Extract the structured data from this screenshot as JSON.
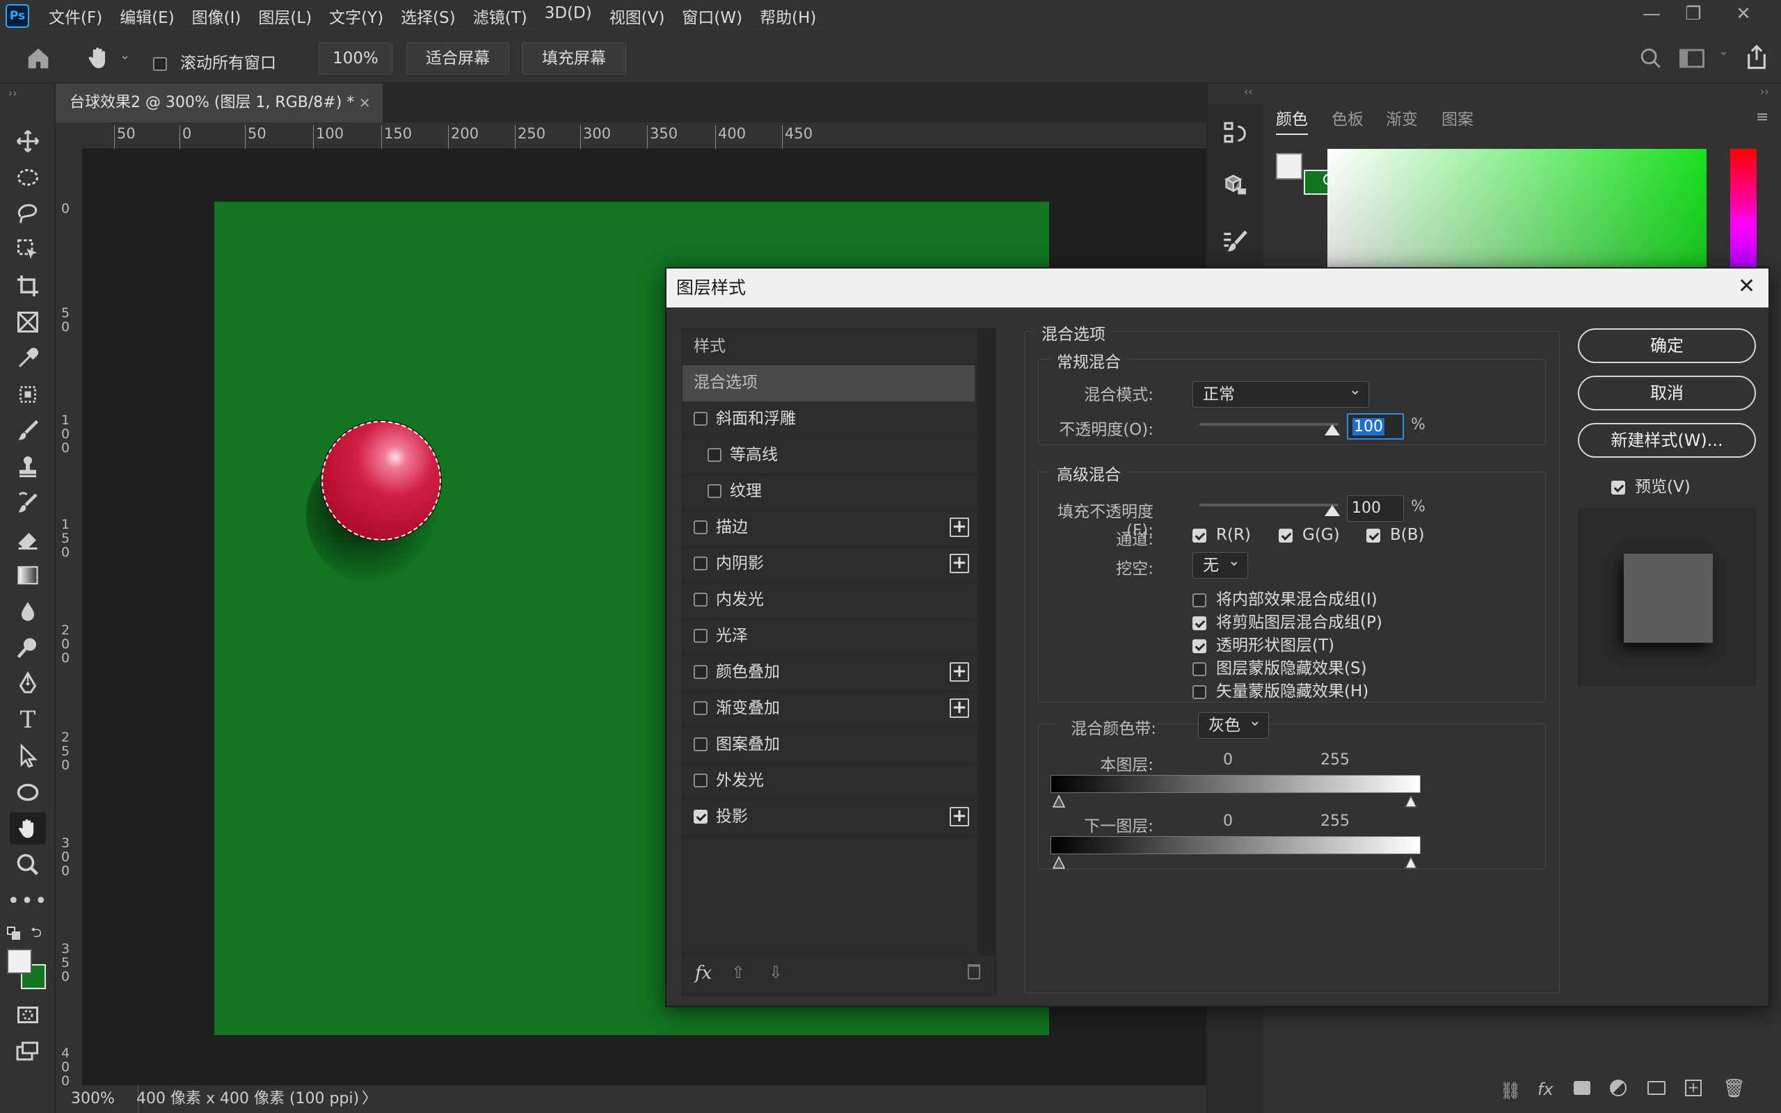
{
  "menubar": {
    "logo": "Ps",
    "items": [
      "文件(F)",
      "编辑(E)",
      "图像(I)",
      "图层(L)",
      "文字(Y)",
      "选择(S)",
      "滤镜(T)",
      "3D(D)",
      "视图(V)",
      "窗口(W)",
      "帮助(H)"
    ]
  },
  "optbar": {
    "scroll_all_label": "滚动所有窗口",
    "zoom_value": "100%",
    "fit_screen": "适合屏幕",
    "fill_screen": "填充屏幕"
  },
  "document": {
    "tab_title": "台球效果2 @ 300% (图层 1, RGB/8#) *",
    "canvas_color": "#117522",
    "ball_color": "#d21f45"
  },
  "ruler": {
    "top_ticks": [
      "50",
      "0",
      "50",
      "100",
      "150",
      "200",
      "250",
      "300",
      "350",
      "400",
      "450"
    ],
    "left_ticks": [
      "0",
      "5\n0",
      "1\n0\n0",
      "1\n5\n0",
      "2\n0\n0",
      "2\n5\n0",
      "3\n0\n0",
      "3\n5\n0",
      "4\n0\n0"
    ]
  },
  "status": {
    "zoom": "300%",
    "doc_info": "400 像素 x 400 像素 (100 ppi)",
    "arrow": "〉"
  },
  "panel": {
    "tabs": [
      "颜色",
      "色板",
      "渐变",
      "图案"
    ]
  },
  "dialog": {
    "title": "图层样式",
    "styles_header": "样式",
    "blend_options": "混合选项",
    "style_items": [
      {
        "label": "斜面和浮雕",
        "checked": false,
        "plus": false,
        "indent": false
      },
      {
        "label": "等高线",
        "checked": false,
        "plus": false,
        "indent": true
      },
      {
        "label": "纹理",
        "checked": false,
        "plus": false,
        "indent": true
      },
      {
        "label": "描边",
        "checked": false,
        "plus": true,
        "indent": false
      },
      {
        "label": "内阴影",
        "checked": false,
        "plus": true,
        "indent": false
      },
      {
        "label": "内发光",
        "checked": false,
        "plus": false,
        "indent": false
      },
      {
        "label": "光泽",
        "checked": false,
        "plus": false,
        "indent": false
      },
      {
        "label": "颜色叠加",
        "checked": false,
        "plus": true,
        "indent": false
      },
      {
        "label": "渐变叠加",
        "checked": false,
        "plus": true,
        "indent": false
      },
      {
        "label": "图案叠加",
        "checked": false,
        "plus": false,
        "indent": false
      },
      {
        "label": "外发光",
        "checked": false,
        "plus": false,
        "indent": false
      },
      {
        "label": "投影",
        "checked": true,
        "plus": true,
        "indent": false
      }
    ],
    "fx_label": "fx",
    "blend_section": "混合选项",
    "general_blend": "常规混合",
    "blend_mode_label": "混合模式:",
    "blend_mode_value": "正常",
    "opacity_label": "不透明度(O):",
    "opacity_value": "100",
    "percent": "%",
    "advanced_blend": "高级混合",
    "fill_opacity_label": "填充不透明度(F):",
    "fill_opacity_value": "100",
    "channels_label": "通道:",
    "channel_r": "R(R)",
    "channel_g": "G(G)",
    "channel_b": "B(B)",
    "knockout_label": "挖空:",
    "knockout_value": "无",
    "options": [
      {
        "label": "将内部效果混合成组(I)",
        "checked": false
      },
      {
        "label": "将剪贴图层混合成组(P)",
        "checked": true
      },
      {
        "label": "透明形状图层(T)",
        "checked": true
      },
      {
        "label": "图层蒙版隐藏效果(S)",
        "checked": false
      },
      {
        "label": "矢量蒙版隐藏效果(H)",
        "checked": false
      }
    ],
    "blend_if_label": "混合颜色带:",
    "blend_if_value": "灰色",
    "this_layer_label": "本图层:",
    "underlying_label": "下一图层:",
    "range_min": "0",
    "range_max": "255",
    "ok": "确定",
    "cancel": "取消",
    "new_style": "新建样式(W)...",
    "preview_label": "预览(V)"
  }
}
